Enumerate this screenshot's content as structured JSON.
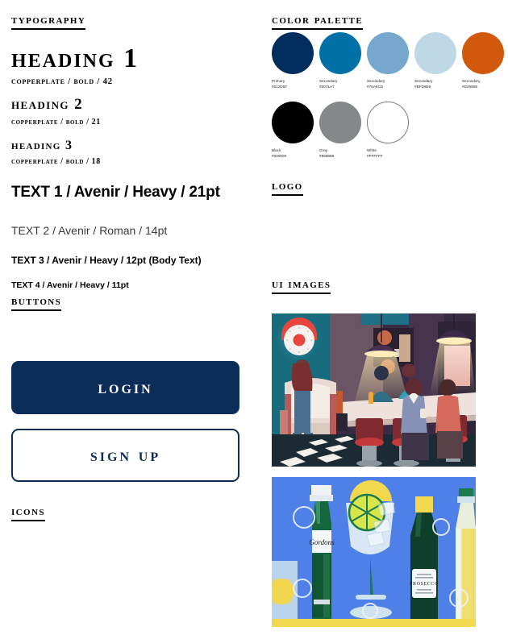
{
  "left_column": {
    "typography": {
      "heading": "Typography",
      "samples": [
        {
          "text": "Heading 1",
          "spec": "Copperplate / Bold / 42"
        },
        {
          "text": "Heading 2",
          "spec": "copperplate / Bold / 21"
        },
        {
          "text": "Heading 3",
          "spec": "copperplate / Bold / 18"
        }
      ],
      "body_samples": [
        "TEXT 1 / Avenir / Heavy / 21pt",
        "TEXT 2 / Avenir / Roman / 14pt",
        "TEXT 3 / Avenir / Heavy / 12pt (Body Text)",
        "TEXT 4 / Avenir / Heavy / 11pt"
      ]
    },
    "buttons": {
      "heading": "Buttons",
      "login_label": "Login",
      "signup_label": "Sign Up",
      "primary_color": "#0B2D58"
    },
    "icons": {
      "heading": "Icons"
    }
  },
  "right_column": {
    "color_palette": {
      "heading": "Color Palette",
      "row_1": [
        {
          "role": "Primary",
          "hex": "#012D5F"
        },
        {
          "role": "Secondary",
          "hex": "#0071A7"
        },
        {
          "role": "Secondary",
          "hex": "#76A8CD"
        },
        {
          "role": "Secondary",
          "hex": "#BFD8E6"
        },
        {
          "role": "Secondary",
          "hex": "#D2580E"
        }
      ],
      "row_2": [
        {
          "role": "Black",
          "hex": "#000000"
        },
        {
          "role": "Gray",
          "hex": "#858889"
        },
        {
          "role": "White",
          "hex": "#FFFFFF"
        }
      ]
    },
    "logo": {
      "heading": "Logo"
    },
    "ui_images": {
      "heading": "UI Images",
      "items": [
        {
          "name": "retro-bar-interior-illustration",
          "alt": "Illustrated retro bar interior with jukebox, neon wall clock, checkered floor, pendant lamps and people seated at the bar"
        },
        {
          "name": "gin-bottles-illustration",
          "alt": "Flat illustration of a Gordons gin bottle, gin and tonic glass with lime and ice, a Prosecco bottle and a white wine bottle on a blue background"
        }
      ],
      "image_1_labels": {
        "clock": "",
        "jukebox": ""
      },
      "image_2_labels": {
        "gin_label": "Gordons",
        "prosecco_label": "PROSECCO"
      }
    }
  }
}
